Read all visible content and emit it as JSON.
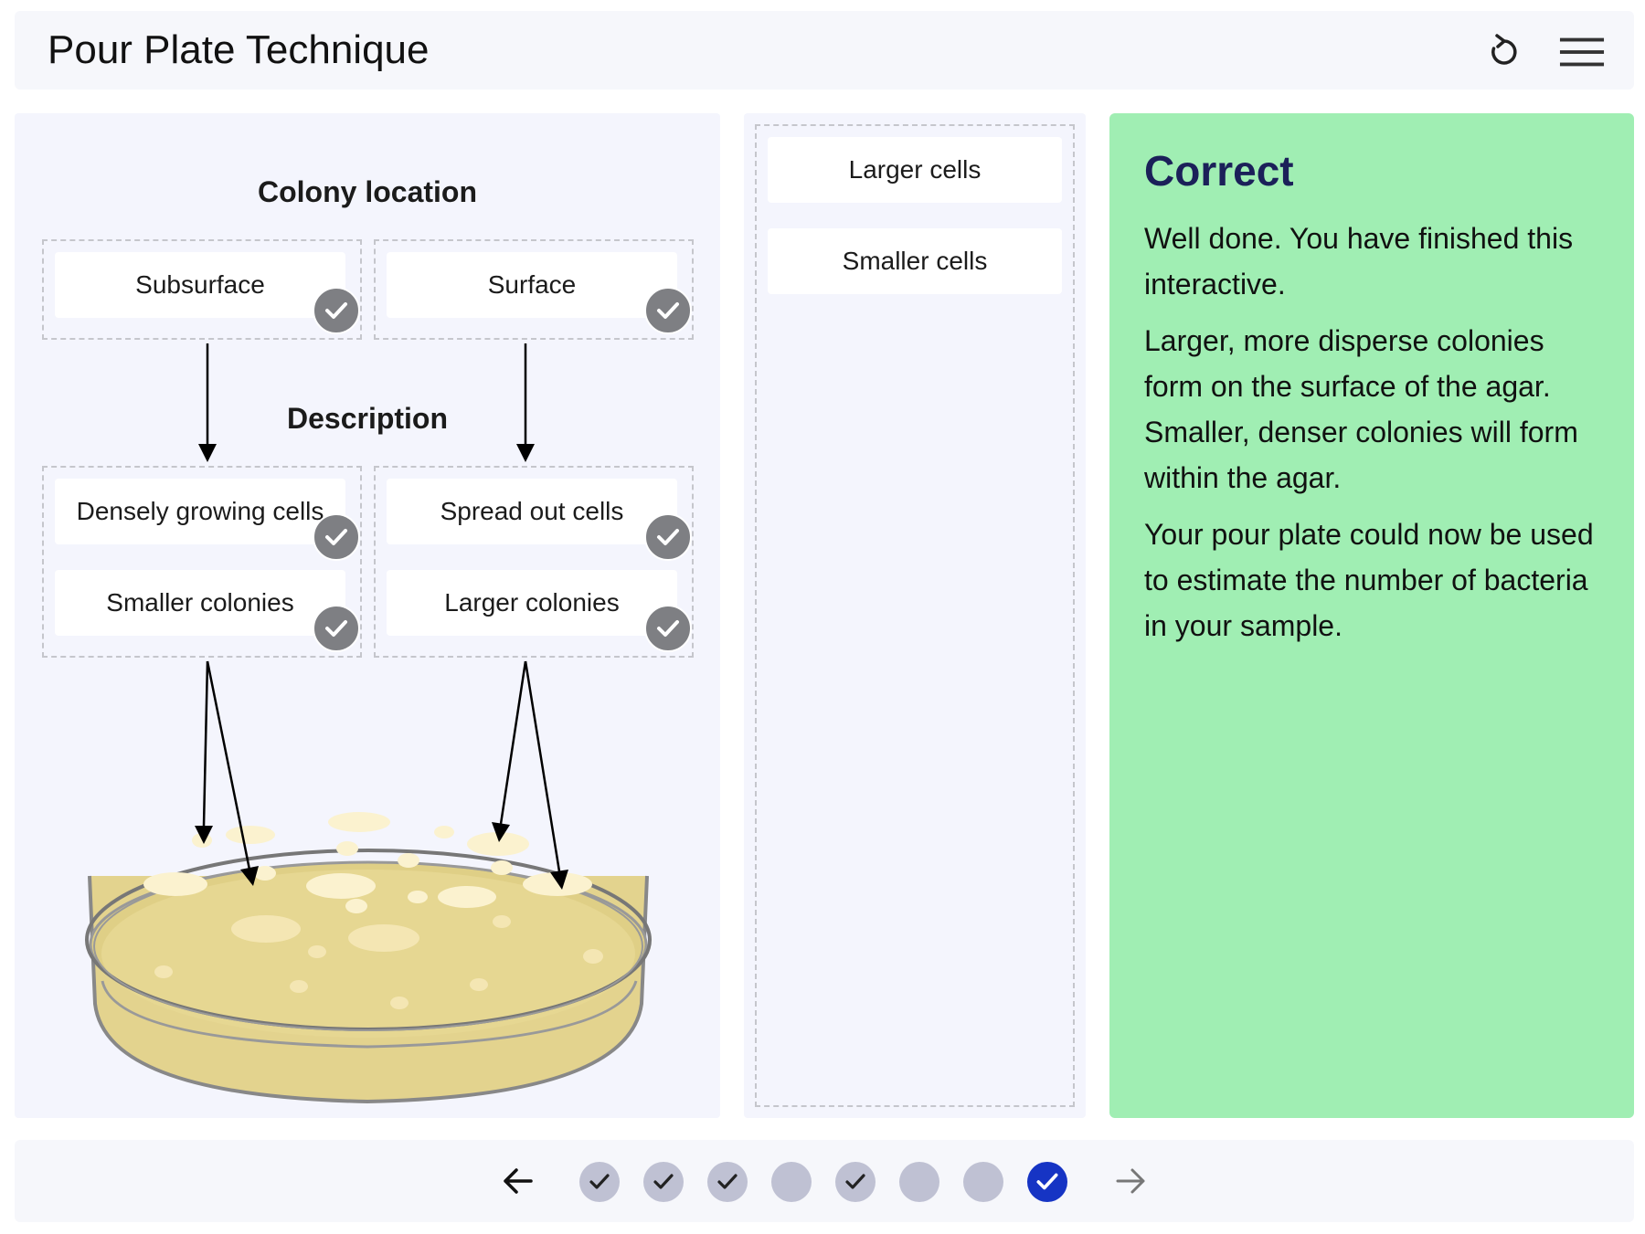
{
  "header": {
    "title": "Pour Plate Technique",
    "reset_icon": "reset-icon",
    "menu_icon": "hamburger-menu-icon"
  },
  "diagram": {
    "colony_location_heading": "Colony location",
    "description_heading": "Description",
    "location_tiles": [
      "Subsurface",
      "Surface"
    ],
    "left_description_tiles": [
      "Densely growing cells",
      "Smaller colonies"
    ],
    "right_description_tiles": [
      "Spread out cells",
      "Larger colonies"
    ],
    "tick_icon": "check-icon"
  },
  "bank": {
    "tiles": [
      "Larger cells",
      "Smaller cells"
    ]
  },
  "feedback": {
    "title": "Correct",
    "paragraphs": [
      "Well done. You have finished this interactive.",
      "Larger, more disperse colonies form on the surface of the agar. Smaller, denser colonies will form within the agar.",
      "Your pour plate could now be used to estimate the number of bacteria in your sample."
    ],
    "background": "#a0eeb3"
  },
  "footer": {
    "prev_icon": "arrow-left-icon",
    "next_icon": "arrow-right-icon",
    "steps": [
      {
        "state": "done"
      },
      {
        "state": "done"
      },
      {
        "state": "done"
      },
      {
        "state": "pending"
      },
      {
        "state": "done"
      },
      {
        "state": "pending"
      },
      {
        "state": "pending"
      },
      {
        "state": "current-done"
      }
    ],
    "accent": "#1634c4"
  }
}
